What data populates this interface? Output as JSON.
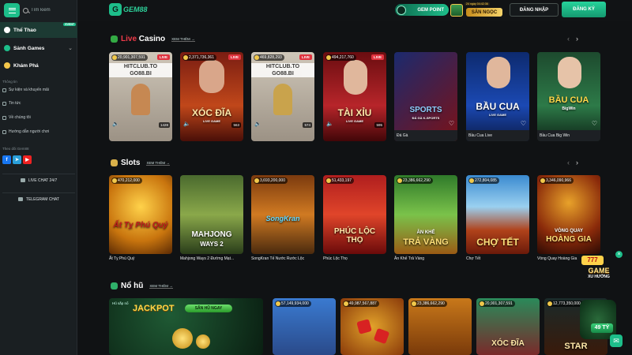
{
  "header": {
    "brand": "GEM88",
    "gem_point": "GEM POINT",
    "hunt_label": "SĂN NGỌC",
    "hunt_timer": "24 ngày 04:42:36",
    "login": "ĐĂNG NHẬP",
    "register": "ĐĂNG KÝ"
  },
  "sidebar": {
    "search_placeholder": "Tìm kiếm",
    "nav": [
      {
        "label": "Thể Thao",
        "badge": "EVENT"
      },
      {
        "label": "Sảnh Games"
      },
      {
        "label": "Khám Phá"
      }
    ],
    "info_head": "Thông tin",
    "links": [
      "Sự kiện và khuyến mãi",
      "Tin tức",
      "Về chúng tôi",
      "Hướng dẫn người chơi"
    ],
    "follow_head": "Theo dõi Gem88",
    "live_chat": "LIVE CHAT 24/7",
    "telegram": "TELEGRAM CHAT"
  },
  "sections": {
    "live": {
      "prefix": "Live",
      "title": "Casino",
      "more": "XEM THÊM"
    },
    "slots": {
      "title": "Slots",
      "more": "XEM THÊM"
    },
    "nohu": {
      "title": "Nổ hũ",
      "more": "XEM THÊM"
    }
  },
  "live_cards": [
    {
      "jackpot": "20,901,307,591",
      "live": "LIVE",
      "overlay": "HITCLUB.TO\nGO88.BI",
      "count": "1428"
    },
    {
      "jackpot": "2,371,736,361",
      "live": "LIVE",
      "title": "XÓC ĐĨA",
      "sub": "LIVE GAME",
      "count": "563"
    },
    {
      "jackpot": "469,828,293",
      "live": "LIVE",
      "overlay": "HITCLUB.TO\nGO88.BI",
      "count": "574"
    },
    {
      "jackpot": "494,217,760",
      "live": "LIVE",
      "title": "TÀI XỈU",
      "sub": "LIVE GAME",
      "count": "595"
    },
    {
      "caption": "Đá Gà",
      "title": "SPORTS",
      "sub": "ĐÁ GÀ K-SPORTS"
    },
    {
      "caption": "Bầu Cua Live",
      "title": "BẦU CUA",
      "sub": "LIVE GAME"
    },
    {
      "caption": "Bầu Cua Big Win",
      "title": "BẦU CUA",
      "sub": "BigWin"
    }
  ],
  "slot_cards": [
    {
      "jackpot": "470,212,000",
      "caption": "Ất Tỵ Phú Quý",
      "title": "Ất Tỵ Phú Quý"
    },
    {
      "caption": "Mahjong Ways 2 Đường Mạt...",
      "title": "MAHJONG",
      "sub": "WAYS 2"
    },
    {
      "jackpot": "3,693,200,000",
      "caption": "SongKran Tế Nước Rước Lộc",
      "title": "SongKran"
    },
    {
      "jackpot": "51,433,197",
      "caption": "Phúc Lộc Thọ",
      "title": "PHÚC LỘC THỌ"
    },
    {
      "jackpot": "23,386,662,290",
      "caption": "Ăn Khế Trả Vàng",
      "title": "TRẢ VÀNG",
      "sub": "ĂN KHẾ"
    },
    {
      "jackpot": "272,804,085",
      "caption": "Chợ Tết",
      "title": "CHỢ TẾT"
    },
    {
      "jackpot": "3,346,090,966",
      "caption": "Vòng Quay Hoàng Gia",
      "title": "HOÀNG GIA",
      "sub": "VÒNG QUAY"
    }
  ],
  "nohu_cards": [
    {
      "jackpot": "57,149,934,000"
    },
    {
      "jackpot": "49,987,567,887"
    },
    {
      "jackpot": "23,386,662,290"
    },
    {
      "jackpot": "20,901,307,591",
      "title": "XÓC ĐĨA"
    },
    {
      "jackpot": "12,773,350,000",
      "title": "STAR"
    }
  ],
  "jackpot_banner": {
    "tag": "Hũ sắp nổ",
    "title": "JACKPOT",
    "button": "SĂN HŨ NGAY"
  },
  "floating": {
    "badge_top": "777",
    "line1": "GAME",
    "line2": "XU HƯỚNG",
    "prize": "49 TỶ"
  }
}
